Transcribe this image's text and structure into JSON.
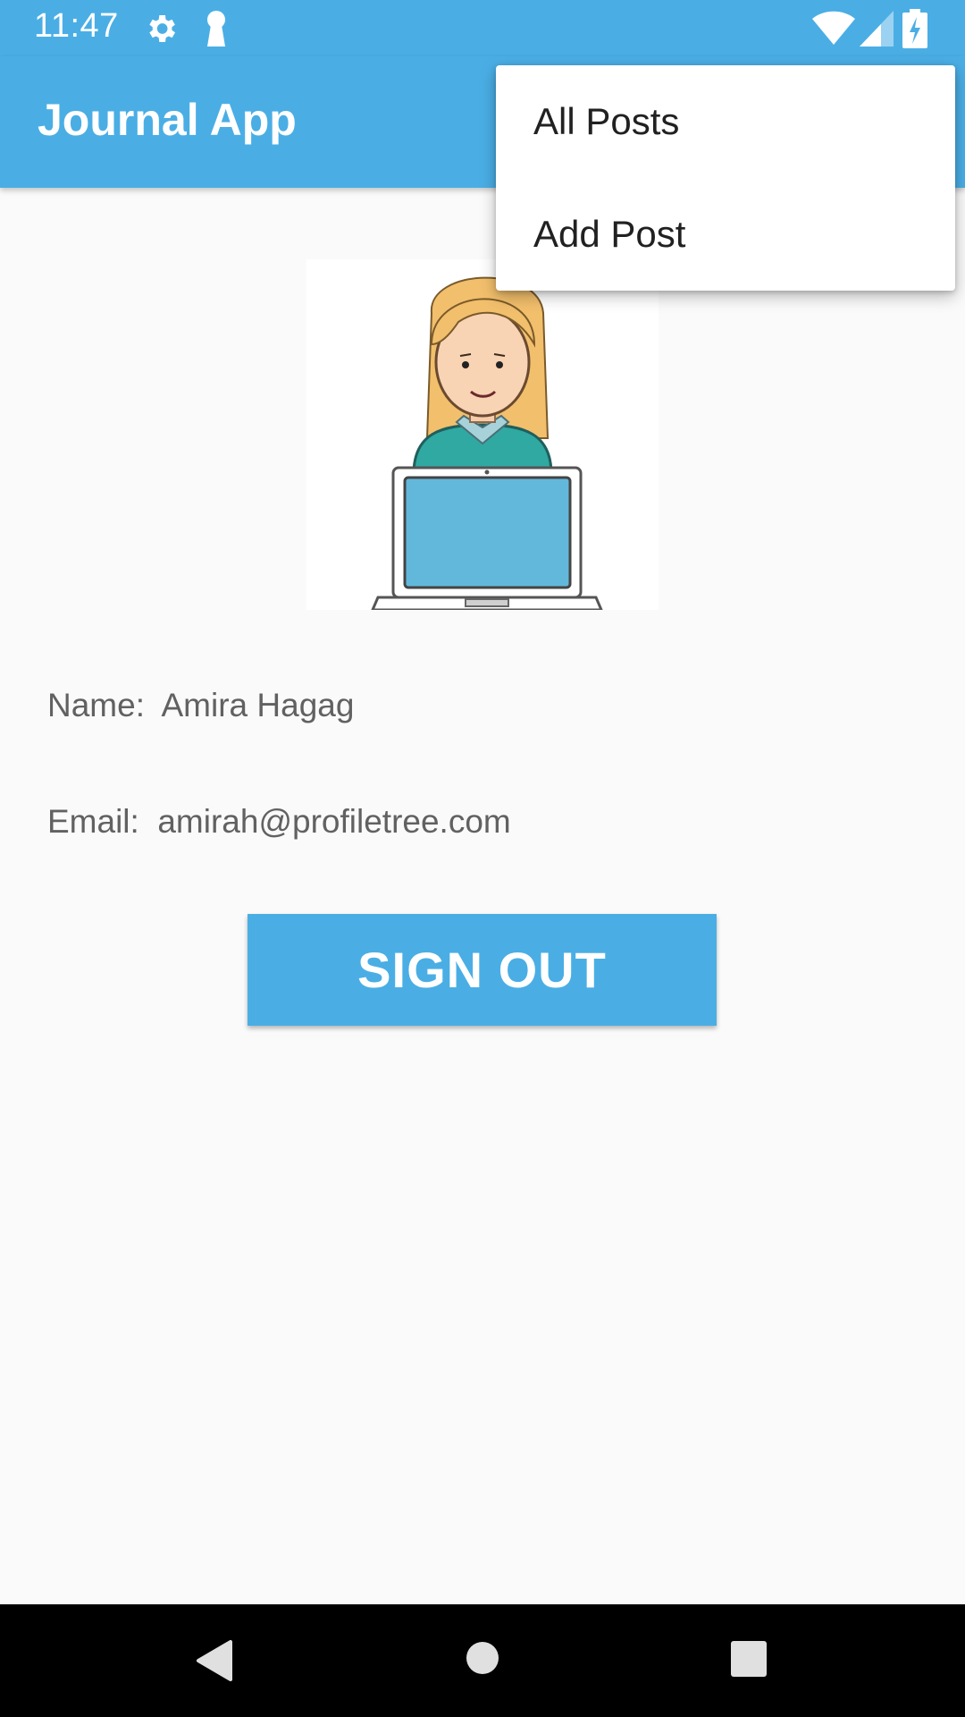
{
  "status_bar": {
    "time": "11:47",
    "icons": [
      "gear-icon",
      "key-icon",
      "wifi-icon",
      "cell-signal-icon",
      "battery-charging-icon"
    ]
  },
  "app_bar": {
    "title": "Journal App",
    "color": "#4aaee5"
  },
  "overflow_menu": {
    "items": [
      {
        "label": "All Posts"
      },
      {
        "label": "Add Post"
      }
    ]
  },
  "profile": {
    "avatar_icon": "woman-with-laptop-illustration",
    "name_line": "Name:  Amira Hagag",
    "email_line": "Email:  amirah@profiletree.com"
  },
  "actions": {
    "signout_label": "SIGN OUT"
  },
  "nav_bar": {
    "icons": [
      "back-icon",
      "home-icon",
      "recents-icon"
    ]
  }
}
